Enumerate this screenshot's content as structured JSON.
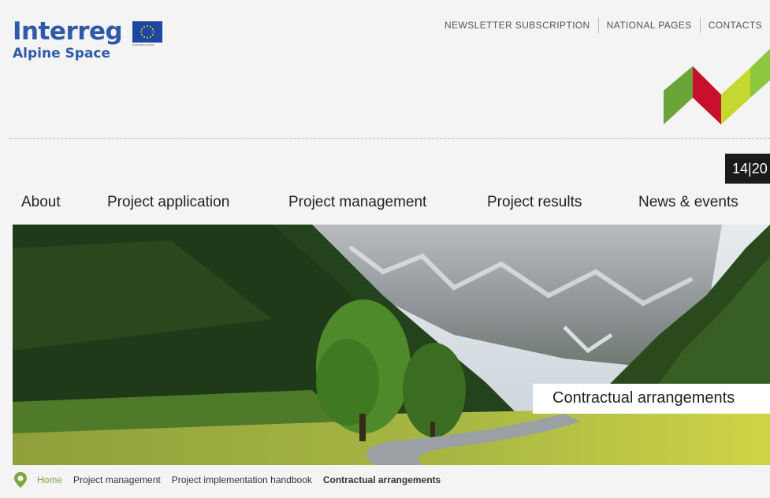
{
  "header": {
    "logo_title": "Interreg",
    "logo_subtitle": "Alpine Space",
    "eu_caption": "EUROPEAN UNION",
    "top_links": [
      "NEWSLETTER SUBSCRIPTION",
      "NATIONAL PAGES",
      "CONTACTS"
    ],
    "period": "14|20"
  },
  "nav": {
    "items": [
      "About",
      "Project application",
      "Project management",
      "Project results",
      "News & events"
    ]
  },
  "hero": {
    "caption": "Contractual arrangements"
  },
  "breadcrumb": {
    "items": [
      "Home",
      "Project management",
      "Project implementation handbook",
      "Contractual arrangements"
    ]
  },
  "colors": {
    "brand_blue": "#2f5aa8",
    "accent_green": "#7aa83b",
    "accent_red": "#c8102e",
    "accent_lime": "#c5d82f"
  }
}
